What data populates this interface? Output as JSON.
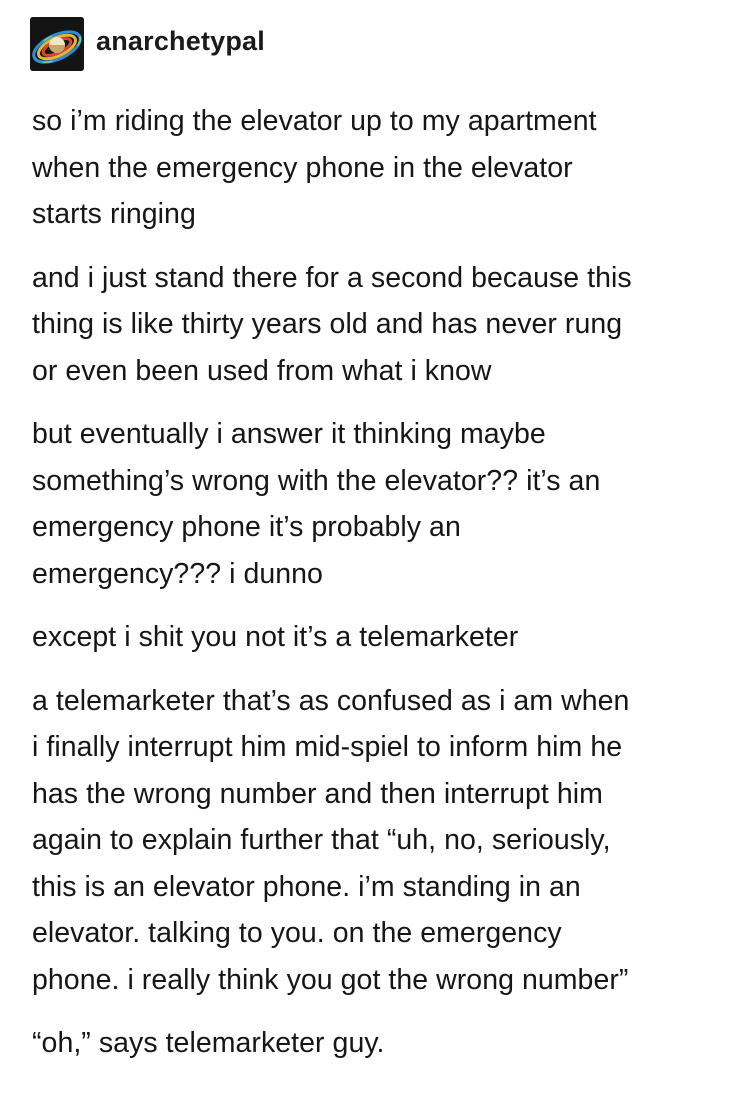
{
  "post": {
    "author": {
      "username": "anarchetypal",
      "avatar_icon": "planet-avatar-icon"
    },
    "paragraphs": [
      "so i’m riding the elevator up to my apartment\nwhen the emergency phone in the elevator\nstarts ringing",
      "and i just stand there for a second because this\nthing is like thirty years old and has never rung\nor even been used from what i know",
      "but eventually i answer it thinking maybe\nsomething’s wrong with the elevator?? it’s an\nemergency phone it’s probably an\nemergency??? i dunno",
      "except i shit you not it’s a telemarketer",
      "a telemarketer that’s as confused as i am when\ni finally interrupt him mid-spiel to inform him he\nhas the wrong number and then interrupt him\nagain to explain further that “uh, no, seriously,\nthis is an elevator phone. i’m standing in an\nelevator. talking to you. on the emergency\nphone. i really think you got the wrong number”",
      "“oh,” says telemarketer guy."
    ]
  },
  "colors": {
    "background": "#ffffff",
    "text": "#161616",
    "username": "#1b1b1b"
  }
}
